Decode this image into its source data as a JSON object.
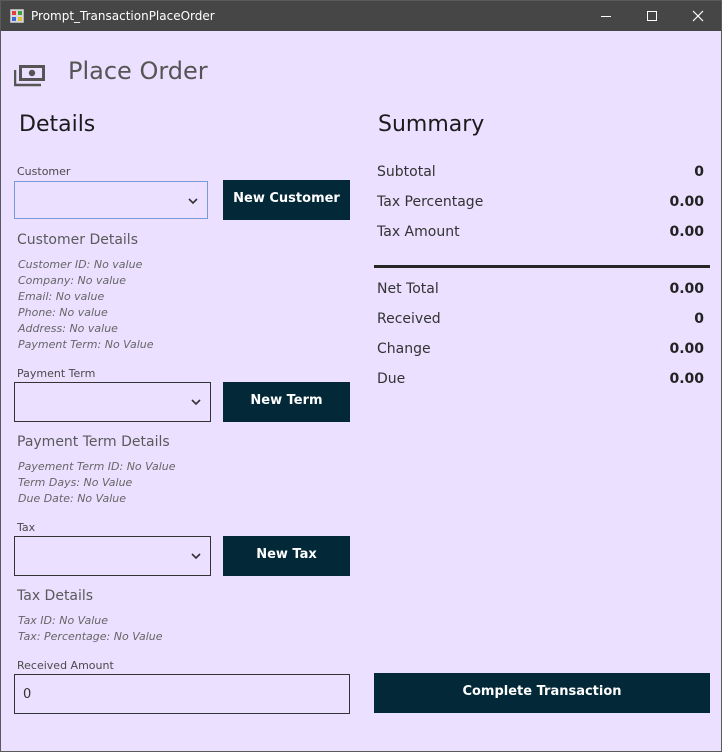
{
  "window": {
    "title": "Prompt_TransactionPlaceOrder"
  },
  "header": {
    "title": "Place Order",
    "icon": "money-icon"
  },
  "details": {
    "title": "Details",
    "customer": {
      "label": "Customer",
      "value": "",
      "button": "New Customer",
      "details_title": "Customer Details",
      "lines": [
        "Customer ID: No value",
        "Company: No value",
        "Email: No value",
        "Phone: No value",
        "Address: No value",
        "Payment Term: No Value"
      ]
    },
    "payment_term": {
      "label": "Payment Term",
      "value": "",
      "button": "New Term",
      "details_title": "Payment Term Details",
      "lines": [
        "Payement Term ID: No Value",
        "Term Days: No Value",
        "Due Date: No Value"
      ]
    },
    "tax": {
      "label": "Tax",
      "value": "",
      "button": "New Tax",
      "details_title": "Tax Details",
      "lines": [
        "Tax ID: No Value",
        "Tax: Percentage: No Value"
      ]
    },
    "received": {
      "label": "Received Amount",
      "value": "0"
    }
  },
  "summary": {
    "title": "Summary",
    "top_rows": [
      {
        "label": "Subtotal",
        "value": "0"
      },
      {
        "label": "Tax Percentage",
        "value": "0.00"
      },
      {
        "label": "Tax Amount",
        "value": "0.00"
      }
    ],
    "bottom_rows": [
      {
        "label": "Net Total",
        "value": "0.00"
      },
      {
        "label": "Received",
        "value": "0"
      },
      {
        "label": "Change",
        "value": "0.00"
      },
      {
        "label": "Due",
        "value": "0.00"
      }
    ],
    "complete_button": "Complete Transaction"
  },
  "colors": {
    "background": "#ebe0ff",
    "titlebar": "#464646",
    "button": "#032838"
  }
}
